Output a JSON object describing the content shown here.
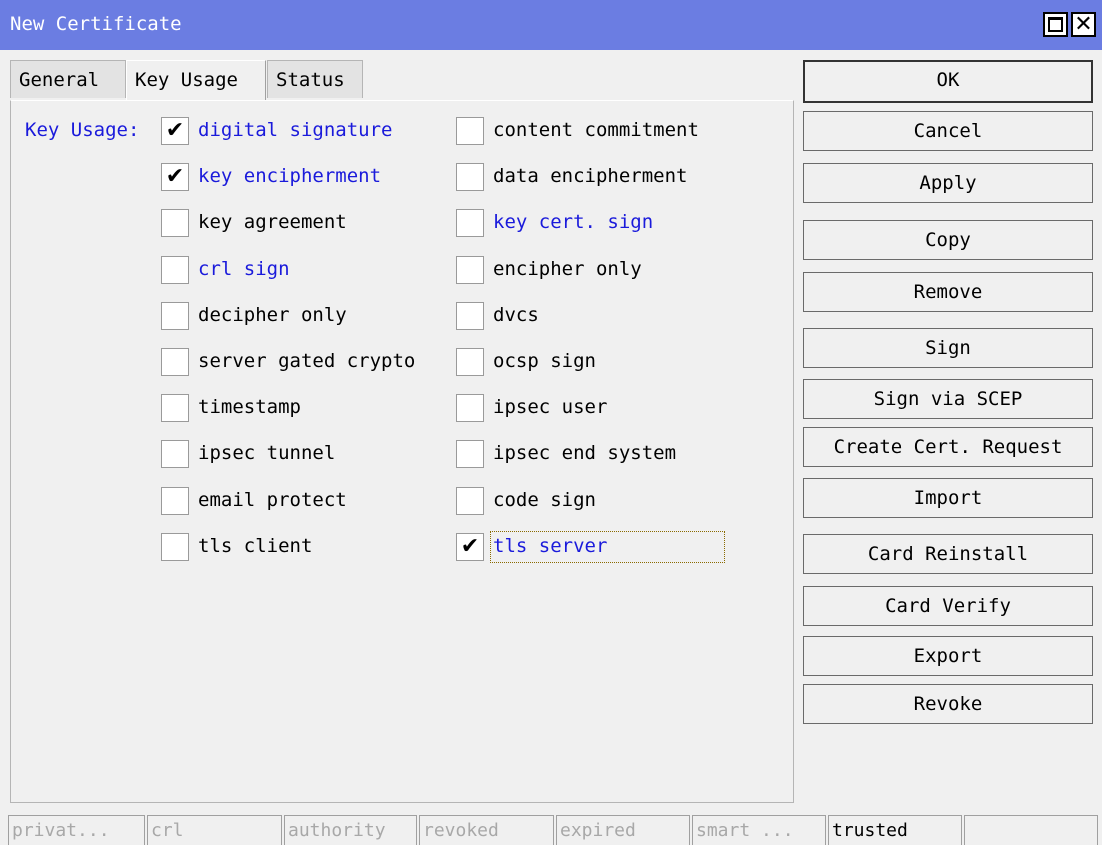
{
  "window": {
    "title": "New Certificate",
    "maximize_icon": "maximize-icon",
    "close_icon": "close-icon",
    "close_glyph": "✕"
  },
  "tabs": [
    {
      "label": "General"
    },
    {
      "label": "Key Usage",
      "active": true
    },
    {
      "label": "Status"
    }
  ],
  "key_usage": {
    "label": "Key Usage:",
    "check_glyph": "✔",
    "items": [
      {
        "label": "digital signature",
        "checked": true,
        "highlight": true
      },
      {
        "label": "content commitment",
        "checked": false,
        "highlight": false
      },
      {
        "label": "key encipherment",
        "checked": true,
        "highlight": true
      },
      {
        "label": "data encipherment",
        "checked": false,
        "highlight": false
      },
      {
        "label": "key agreement",
        "checked": false,
        "highlight": false
      },
      {
        "label": "key cert. sign",
        "checked": false,
        "highlight": true
      },
      {
        "label": "crl sign",
        "checked": false,
        "highlight": true
      },
      {
        "label": "encipher only",
        "checked": false,
        "highlight": false
      },
      {
        "label": "decipher only",
        "checked": false,
        "highlight": false
      },
      {
        "label": "dvcs",
        "checked": false,
        "highlight": false
      },
      {
        "label": "server gated crypto",
        "checked": false,
        "highlight": false
      },
      {
        "label": "ocsp sign",
        "checked": false,
        "highlight": false
      },
      {
        "label": "timestamp",
        "checked": false,
        "highlight": false
      },
      {
        "label": "ipsec user",
        "checked": false,
        "highlight": false
      },
      {
        "label": "ipsec tunnel",
        "checked": false,
        "highlight": false
      },
      {
        "label": "ipsec end system",
        "checked": false,
        "highlight": false
      },
      {
        "label": "email protect",
        "checked": false,
        "highlight": false
      },
      {
        "label": "code sign",
        "checked": false,
        "highlight": false
      },
      {
        "label": "tls client",
        "checked": false,
        "highlight": false
      },
      {
        "label": "tls server",
        "checked": true,
        "highlight": true,
        "focused": true
      }
    ]
  },
  "buttons": [
    {
      "label": "OK"
    },
    {
      "label": "Cancel"
    },
    {
      "label": "Apply"
    },
    {
      "label": "Copy"
    },
    {
      "label": "Remove"
    },
    {
      "label": "Sign"
    },
    {
      "label": "Sign via SCEP"
    },
    {
      "label": "Create Cert. Request"
    },
    {
      "label": "Import"
    },
    {
      "label": "Card Reinstall"
    },
    {
      "label": "Card Verify"
    },
    {
      "label": "Export"
    },
    {
      "label": "Revoke"
    }
  ],
  "status_bar": [
    {
      "label": "privat...",
      "active": false
    },
    {
      "label": "crl",
      "active": false
    },
    {
      "label": "authority",
      "active": false
    },
    {
      "label": "revoked",
      "active": false
    },
    {
      "label": "expired",
      "active": false
    },
    {
      "label": "smart ...",
      "active": false
    },
    {
      "label": "trusted",
      "active": true
    },
    {
      "label": "",
      "active": false
    }
  ],
  "colors": {
    "titlebar": "#6b7de2",
    "highlight_text": "#1a1adb",
    "background": "#f0f0f0"
  }
}
